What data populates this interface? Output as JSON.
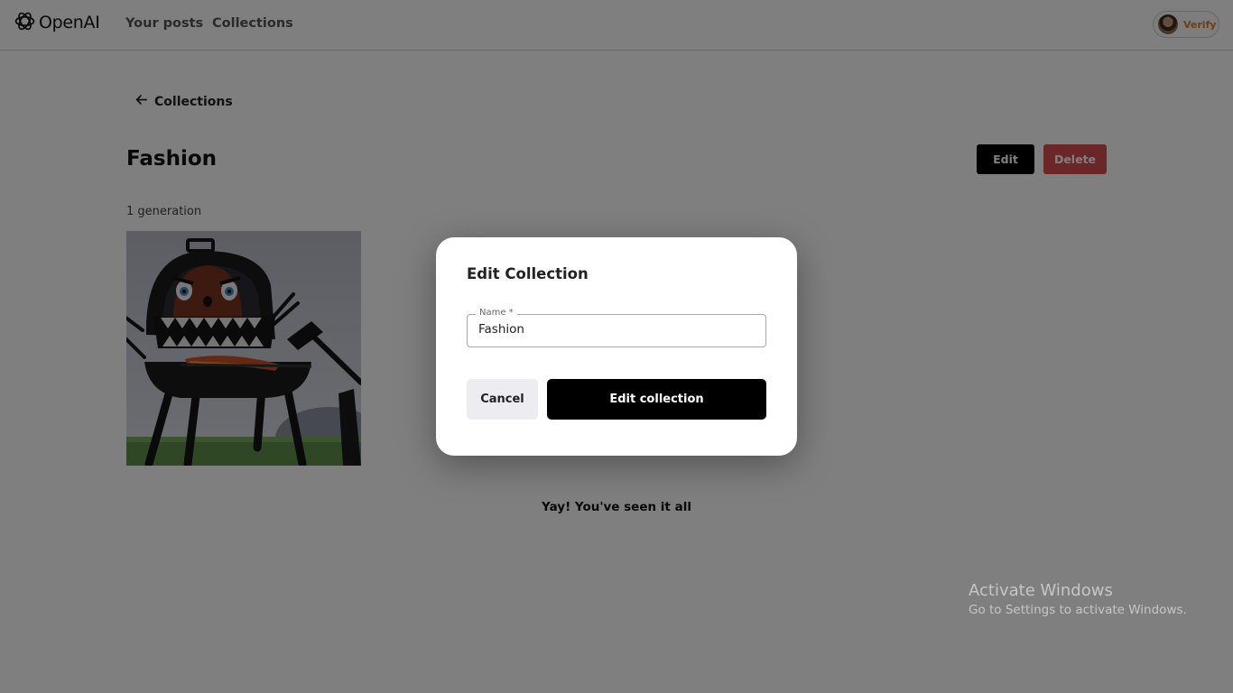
{
  "header": {
    "brand": "OpenAI",
    "nav": [
      {
        "label": "Your posts"
      },
      {
        "label": "Collections"
      }
    ],
    "account": {
      "verify_label": "Verify"
    }
  },
  "page": {
    "back_label": "Collections",
    "title": "Fashion",
    "edit_label": "Edit",
    "delete_label": "Delete",
    "count_text": "1 generation",
    "end_text": "Yay! You've seen it all"
  },
  "modal": {
    "title": "Edit Collection",
    "name_label": "Name *",
    "name_value": "Fashion",
    "cancel_label": "Cancel",
    "submit_label": "Edit collection"
  },
  "watermark": {
    "title": "Activate Windows",
    "subtitle": "Go to Settings to activate Windows."
  },
  "colors": {
    "primary": "#000000",
    "danger": "#d64f4f",
    "verify": "#e07a2c",
    "overlay": "rgba(0,0,0,0.5)"
  }
}
